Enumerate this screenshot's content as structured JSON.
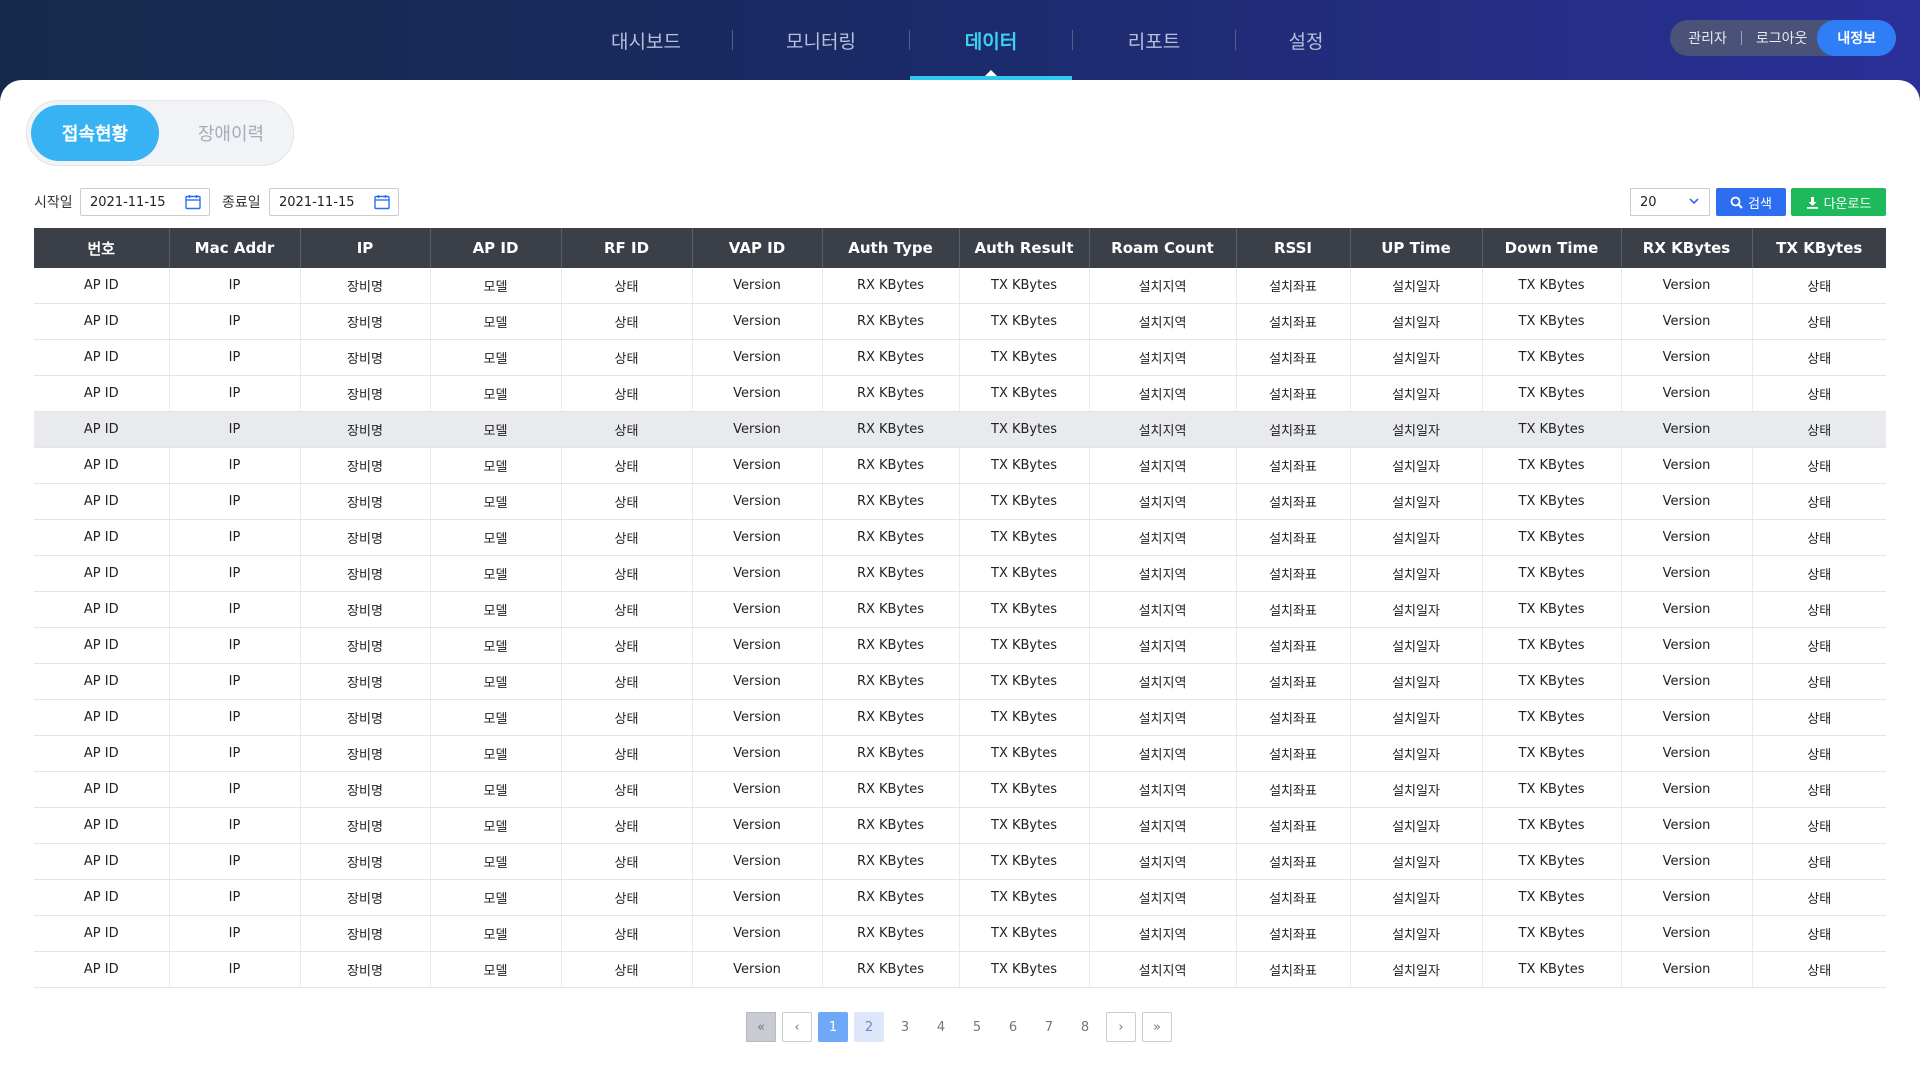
{
  "nav": {
    "items": [
      {
        "label": "대시보드",
        "active": false
      },
      {
        "label": "모니터링",
        "active": false
      },
      {
        "label": "데이터",
        "active": true
      },
      {
        "label": "리포트",
        "active": false
      },
      {
        "label": "설정",
        "active": false
      }
    ]
  },
  "user": {
    "role": "관리자",
    "logout": "로그아웃",
    "myinfo": "내정보"
  },
  "tabs": [
    {
      "label": "접속현황",
      "active": true
    },
    {
      "label": "장애이력",
      "active": false
    }
  ],
  "filters": {
    "start_label": "시작일",
    "start_value": "2021-11-15",
    "end_label": "종료일",
    "end_value": "2021-11-15",
    "page_size": "20",
    "search_label": "검색",
    "download_label": "다운로드"
  },
  "table": {
    "columns": [
      "번호",
      "Mac Addr",
      "IP",
      "AP ID",
      "RF ID",
      "VAP ID",
      "Auth Type",
      "Auth Result",
      "Roam Count",
      "RSSI",
      "UP Time",
      "Down Time",
      "RX KBytes",
      "TX KBytes"
    ],
    "row_template": [
      "AP ID",
      "IP",
      "장비명",
      "모델",
      "상태",
      "Version",
      "RX KBytes",
      "TX KBytes",
      "설치지역",
      "설치좌표",
      "설치일자",
      "TX KBytes",
      "Version",
      "상태"
    ],
    "row_count": 20,
    "highlighted_row": 5
  },
  "pagination": {
    "first": "«",
    "prev": "‹",
    "next": "›",
    "last": "»",
    "pages": [
      "1",
      "2",
      "3",
      "4",
      "5",
      "6",
      "7",
      "8"
    ],
    "current": "1"
  },
  "colors": {
    "accent": "#37b3f3",
    "nav_active": "#3fd0f0",
    "header_bg": "#3b3f47",
    "search": "#2d6ef0",
    "download": "#1db95a"
  }
}
